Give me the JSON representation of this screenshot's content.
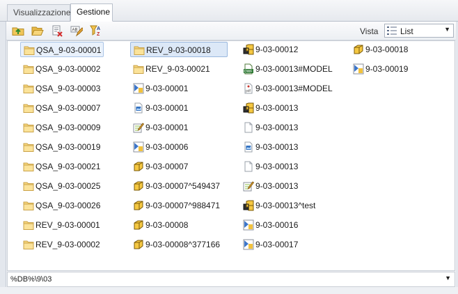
{
  "tabs": [
    {
      "label": "Visualizzazione",
      "active": false
    },
    {
      "label": "Gestione",
      "active": true
    }
  ],
  "toolbar": {
    "buttons": [
      "folder-up-icon",
      "open-folder-icon",
      "delete-icon",
      "rename-icon",
      "sort-filter-icon"
    ],
    "view_label": "Vista",
    "view_value": "List"
  },
  "files": [
    {
      "name": "QSA_9-03-00001",
      "type": "folder"
    },
    {
      "name": "QSA_9-03-00002",
      "type": "folder"
    },
    {
      "name": "QSA_9-03-00003",
      "type": "folder"
    },
    {
      "name": "QSA_9-03-00007",
      "type": "folder"
    },
    {
      "name": "QSA_9-03-00009",
      "type": "folder"
    },
    {
      "name": "QSA_9-03-00019",
      "type": "folder"
    },
    {
      "name": "QSA_9-03-00021",
      "type": "folder"
    },
    {
      "name": "QSA_9-03-00025",
      "type": "folder"
    },
    {
      "name": "QSA_9-03-00026",
      "type": "folder"
    },
    {
      "name": "REV_9-03-00001",
      "type": "folder"
    },
    {
      "name": "REV_9-03-00002",
      "type": "folder"
    },
    {
      "name": "REV_9-03-00018",
      "type": "folder"
    },
    {
      "name": "REV_9-03-00021",
      "type": "folder"
    },
    {
      "name": "9-03-00001",
      "type": "drawing"
    },
    {
      "name": "9-03-00001",
      "type": "image"
    },
    {
      "name": "9-03-00001",
      "type": "note"
    },
    {
      "name": "9-03-00006",
      "type": "drawing"
    },
    {
      "name": "9-03-00007",
      "type": "part"
    },
    {
      "name": "9-03-00007^549437",
      "type": "part"
    },
    {
      "name": "9-03-00007^988471",
      "type": "part"
    },
    {
      "name": "9-03-00008",
      "type": "part"
    },
    {
      "name": "9-03-00008^377166",
      "type": "part"
    },
    {
      "name": "9-03-00012",
      "type": "assembly"
    },
    {
      "name": "9-03-00013#MODEL",
      "type": "dwf"
    },
    {
      "name": "9-03-00013#MODEL",
      "type": "pdf"
    },
    {
      "name": "9-03-00013",
      "type": "assembly"
    },
    {
      "name": "9-03-00013",
      "type": "blank"
    },
    {
      "name": "9-03-00013",
      "type": "image"
    },
    {
      "name": "9-03-00013",
      "type": "blank"
    },
    {
      "name": "9-03-00013",
      "type": "note"
    },
    {
      "name": "9-03-00013^test",
      "type": "assembly"
    },
    {
      "name": "9-03-00016",
      "type": "drawing"
    },
    {
      "name": "9-03-00017",
      "type": "drawing"
    },
    {
      "name": "9-03-00018",
      "type": "part"
    },
    {
      "name": "9-03-00019",
      "type": "drawing"
    }
  ],
  "selected_index": 0,
  "hover_index": 11,
  "path": "%DB%\\9\\03"
}
